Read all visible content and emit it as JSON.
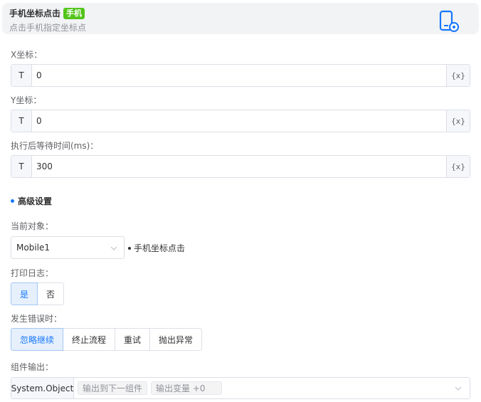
{
  "header": {
    "title": "手机坐标点击",
    "tag": "手机",
    "subtitle": "点击手机指定坐标点",
    "icon": "phone-gear-icon",
    "accent": "#1677ff"
  },
  "fields": {
    "x": {
      "label": "X坐标：",
      "prefix": "T",
      "value": "0",
      "suffix": "{x}"
    },
    "y": {
      "label": "Y坐标：",
      "prefix": "T",
      "value": "0",
      "suffix": "{x}"
    },
    "wait": {
      "label": "执行后等待时间(ms)：",
      "prefix": "T",
      "value": "300",
      "suffix": "{x}"
    }
  },
  "advanced": {
    "title": "高级设置",
    "current_object": {
      "label": "当前对象：",
      "selected": "Mobile1",
      "note": "手机坐标点击"
    },
    "print_log": {
      "label": "打印日志：",
      "options": [
        "是",
        "否"
      ],
      "selected": "是"
    },
    "on_error": {
      "label": "发生错误时：",
      "options": [
        "忽略继续",
        "终止流程",
        "重试",
        "抛出异常"
      ],
      "selected": "忽略继续"
    },
    "output": {
      "label": "组件输出：",
      "type": "System.Object",
      "chip1": "输出到下一组件",
      "chip2": "输出变量 +0"
    }
  }
}
